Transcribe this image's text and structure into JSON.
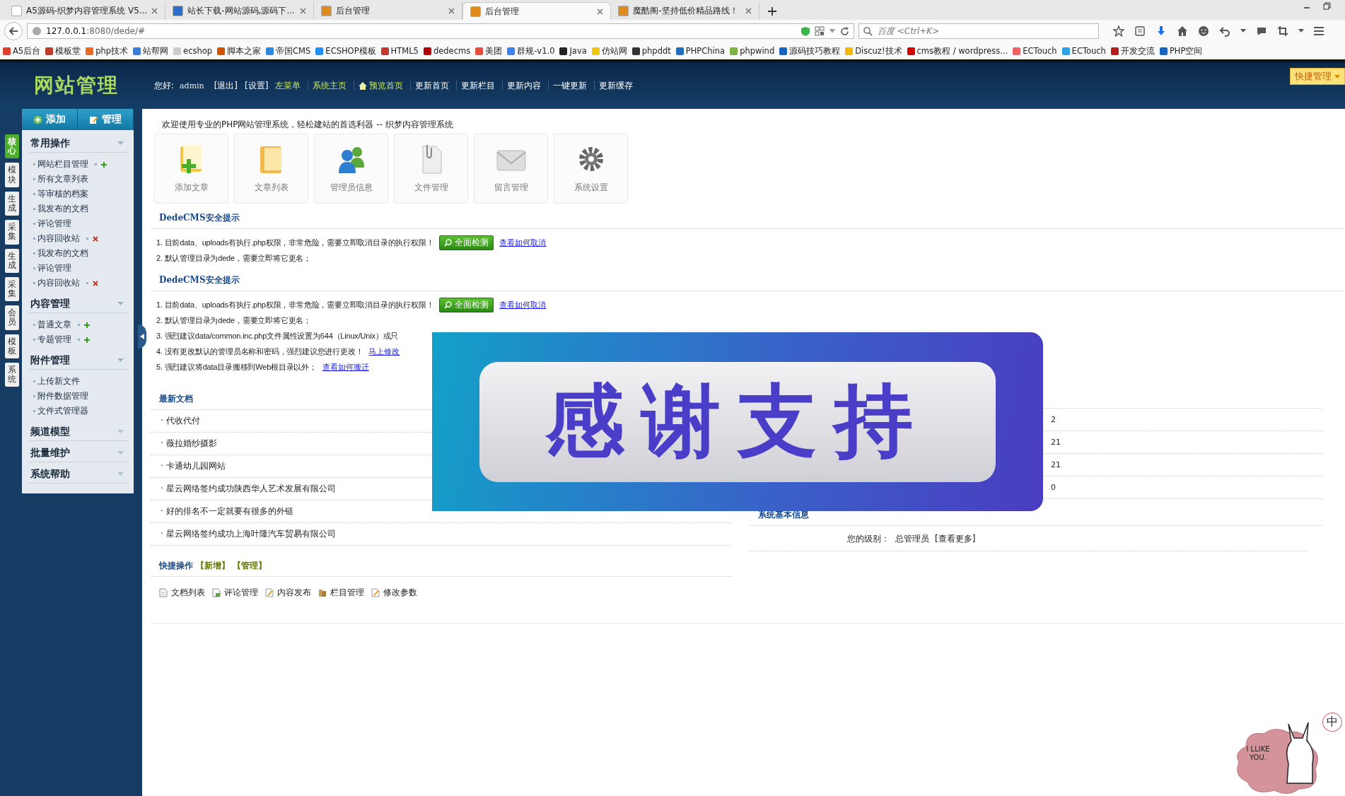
{
  "browser": {
    "tabs": [
      {
        "title": "A5源码-织梦内容管理系统 V5...",
        "selected": false,
        "color": "#ffffff"
      },
      {
        "title": "站长下载-网站源码,源码下...",
        "selected": false,
        "color": "#2a6fc9"
      },
      {
        "title": "后台管理",
        "selected": false,
        "color": "#e08a1e"
      },
      {
        "title": "后台管理",
        "selected": true,
        "color": "#e08a1e"
      },
      {
        "title": "魔酷阁-坚持低价精品路线！",
        "selected": false,
        "color": "#e08a1e"
      }
    ],
    "url_host": "127.0.0.1",
    "url_rest": ":8080/dede/#",
    "search_placeholder": "百度 <Ctrl+K>",
    "bookmarks": [
      {
        "label": "A5后台",
        "color": "#e0402a"
      },
      {
        "label": "模板堂",
        "color": "#c0392b"
      },
      {
        "label": "php技术",
        "color": "#e86a1a"
      },
      {
        "label": "站帮网",
        "color": "#3a7fd5"
      },
      {
        "label": "ecshop",
        "color": "#cccccc"
      },
      {
        "label": "脚本之家",
        "color": "#d35400"
      },
      {
        "label": "帝国CMS",
        "color": "#2e86de"
      },
      {
        "label": "ECSHOP模板",
        "color": "#1e90ff"
      },
      {
        "label": "HTML5",
        "color": "#c0392b"
      },
      {
        "label": "dedecms",
        "color": "#b00000"
      },
      {
        "label": "美团",
        "color": "#e74c3c"
      },
      {
        "label": "群规-v1.0",
        "color": "#3b82f6"
      },
      {
        "label": "Java",
        "color": "#222222"
      },
      {
        "label": "仿站网",
        "color": "#f1c40f"
      },
      {
        "label": "phpddt",
        "color": "#333333"
      },
      {
        "label": "PHPChina",
        "color": "#1f6fbf"
      },
      {
        "label": "phpwind",
        "color": "#7cb342"
      },
      {
        "label": "源码技巧教程",
        "color": "#1565c0"
      },
      {
        "label": "Discuz!技术",
        "color": "#f5b700"
      },
      {
        "label": "cms教程 / wordpress...",
        "color": "#d50000"
      },
      {
        "label": "ECTouch",
        "color": "#f06262"
      },
      {
        "label": "ECTouch",
        "color": "#29a3e6"
      },
      {
        "label": "开发交流",
        "color": "#b71c1c"
      },
      {
        "label": "PHP空间",
        "color": "#1565c0"
      }
    ]
  },
  "header": {
    "logo": "网站管理",
    "greeting": "您好:",
    "user": "admin",
    "links": [
      {
        "label": "[退出]",
        "kind": "bracket"
      },
      {
        "label": "[设置]",
        "kind": "bracket"
      },
      {
        "label": "左菜单",
        "kind": "highlight"
      },
      {
        "label": "系统主页",
        "kind": "highlight"
      },
      {
        "label": "预览首页",
        "kind": "home"
      },
      {
        "label": "更新首页",
        "kind": "update"
      },
      {
        "label": "更新栏目",
        "kind": "update"
      },
      {
        "label": "更新内容",
        "kind": "update"
      },
      {
        "label": "一键更新",
        "kind": "update"
      },
      {
        "label": "更新缓存",
        "kind": "update"
      }
    ],
    "quick_menu": "快捷管理"
  },
  "sidebar": {
    "tabs": [
      {
        "label": "核心",
        "selected": true
      },
      {
        "label": "模块",
        "selected": false
      },
      {
        "label": "生成",
        "selected": false
      },
      {
        "label": "采集",
        "selected": false
      },
      {
        "label": "生成",
        "selected": false
      },
      {
        "label": "采集",
        "selected": false
      },
      {
        "label": "会员",
        "selected": false
      },
      {
        "label": "模板",
        "selected": false
      },
      {
        "label": "系统",
        "selected": false
      }
    ],
    "buttons": [
      {
        "label": "添加",
        "kind": "add"
      },
      {
        "label": "管理",
        "kind": "edit"
      }
    ],
    "groups": [
      {
        "title": "常用操作",
        "expanded": true,
        "items": [
          {
            "label": "网站栏目管理",
            "kind": "add"
          },
          {
            "label": "所有文章列表",
            "kind": "plain"
          },
          {
            "label": "等审核的档案",
            "kind": "plain"
          },
          {
            "label": "我发布的文档",
            "kind": "plain"
          },
          {
            "label": "评论管理",
            "kind": "plain"
          },
          {
            "label": "内容回收站",
            "kind": "remove"
          },
          {
            "label": "我发布的文档",
            "kind": "plain"
          },
          {
            "label": "评论管理",
            "kind": "plain"
          },
          {
            "label": "内容回收站",
            "kind": "remove"
          }
        ]
      },
      {
        "title": "内容管理",
        "expanded": true,
        "items": [
          {
            "label": "普通文章",
            "kind": "add"
          },
          {
            "label": "专题管理",
            "kind": "add"
          }
        ]
      },
      {
        "title": "附件管理",
        "expanded": true,
        "items": [
          {
            "label": "上传新文件",
            "kind": "plain"
          },
          {
            "label": "附件数据管理",
            "kind": "plain"
          },
          {
            "label": "文件式管理器",
            "kind": "plain"
          }
        ]
      },
      {
        "title": "频道模型",
        "expanded": false
      },
      {
        "title": "批量维护",
        "expanded": false
      },
      {
        "title": "系统帮助",
        "expanded": false
      }
    ]
  },
  "main": {
    "welcome": "欢迎使用专业的PHP网站管理系统，轻松建站的首选利器 -- 织梦内容管理系统",
    "shortcuts": [
      {
        "label": "添加文章",
        "kind": "add-doc"
      },
      {
        "label": "文章列表",
        "kind": "folder"
      },
      {
        "label": "管理员信息",
        "kind": "users"
      },
      {
        "label": "文件管理",
        "kind": "file"
      },
      {
        "label": "留言管理",
        "kind": "mail"
      },
      {
        "label": "系统设置",
        "kind": "gear"
      }
    ],
    "notices": [
      {
        "title": "DedeCMS安全提示",
        "items": [
          {
            "text": "1. 目前data、uploads有执行.php权限，非常危险，需要立即取消目录的执行权限！",
            "button": "全面检测",
            "link": "查看如何取消"
          },
          {
            "text": "2. 默认管理目录为dede，需要立即将它更名；"
          }
        ]
      },
      {
        "title": "DedeCMS安全提示",
        "items": [
          {
            "text": "1. 目前data、uploads有执行.php权限，非常危险，需要立即取消目录的执行权限！",
            "button": "全面检测",
            "link": "查看如何取消"
          },
          {
            "text": "2. 默认管理目录为dede，需要立即将它更名；"
          },
          {
            "text": "3. 强烈建议data/common.inc.php文件属性设置为644（Linux/Unix）或只"
          },
          {
            "text": "4. 没有更改默认的管理员名称和密码，强烈建议您进行更改！",
            "link": "马上修改"
          },
          {
            "text": "5. 强烈建议将data目录搬移到Web根目录以外；",
            "link": "查看如何搬迁"
          }
        ]
      }
    ],
    "latest": {
      "title": "最新文档",
      "items": [
        "· 代收代付",
        "· 薇拉婚纱摄影",
        "· 卡通幼儿园网站",
        "· 星云网络签约成功陕西华人艺术发展有限公司",
        "· 好的排名不一定就要有很多的外链",
        "· 星云网络签约成功上海叶隆汽车贸易有限公司"
      ]
    },
    "side_rows": [
      "2",
      "21",
      "21",
      "0"
    ],
    "sysinfo": {
      "title": "系统基本信息",
      "label": "您的级别：",
      "value": "总管理员",
      "link": "[查看更多]"
    },
    "quick": {
      "title": "快捷操作",
      "links": [
        "【新增】",
        "【管理】"
      ],
      "items": [
        {
          "label": "文档列表",
          "kind": "doc"
        },
        {
          "label": "评论管理",
          "kind": "comment"
        },
        {
          "label": "内容发布",
          "kind": "edit"
        },
        {
          "label": "栏目管理",
          "kind": "column"
        },
        {
          "label": "修改参数",
          "kind": "edit"
        }
      ]
    },
    "overlay": {
      "text": "感谢支持"
    }
  },
  "widget": {
    "speech": "I LLIKE YOU.",
    "ime": "中"
  }
}
